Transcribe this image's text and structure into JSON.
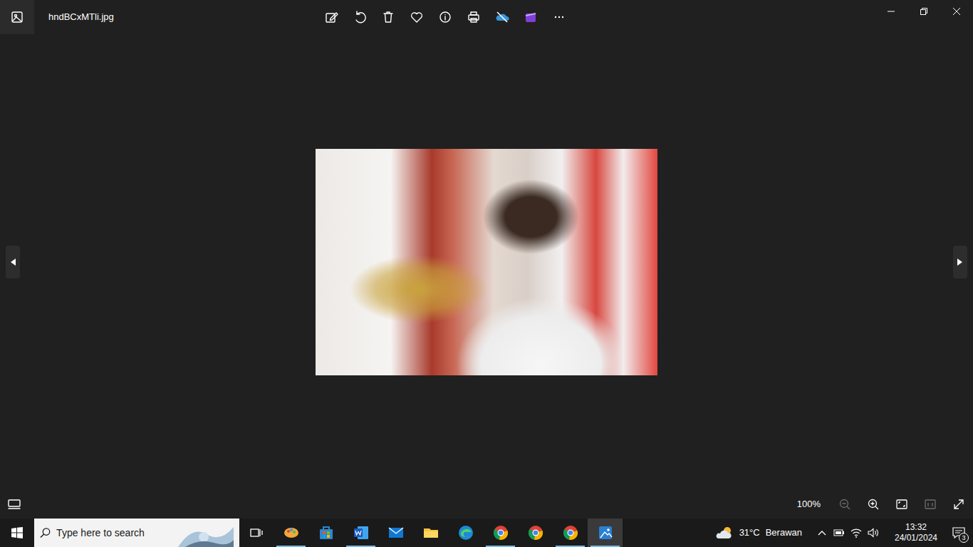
{
  "window": {
    "title": "hndBCxMTli.jpg"
  },
  "zoom": {
    "reading": "100%",
    "zoom_out_disabled": true,
    "zoom_in_disabled": false,
    "actual_size_disabled": true
  },
  "taskbar": {
    "search": {
      "placeholder": "Type here to search"
    },
    "apps": [
      {
        "kind": "paint",
        "running": true,
        "selected": false
      },
      {
        "kind": "store",
        "running": false,
        "selected": false
      },
      {
        "kind": "word",
        "running": true,
        "selected": false
      },
      {
        "kind": "mail",
        "running": false,
        "selected": false
      },
      {
        "kind": "explorer",
        "running": false,
        "selected": false
      },
      {
        "kind": "edge",
        "running": false,
        "selected": false
      },
      {
        "kind": "chrome",
        "running": true,
        "selected": false
      },
      {
        "kind": "chrome",
        "running": false,
        "selected": false
      },
      {
        "kind": "chrome",
        "running": true,
        "selected": false
      },
      {
        "kind": "photos",
        "running": true,
        "selected": true
      }
    ],
    "weather": {
      "temperature": "31°C",
      "condition": "Berawan"
    },
    "clock": {
      "time": "13:32",
      "date": "24/01/2024"
    },
    "notifications": {
      "count": "3"
    }
  }
}
